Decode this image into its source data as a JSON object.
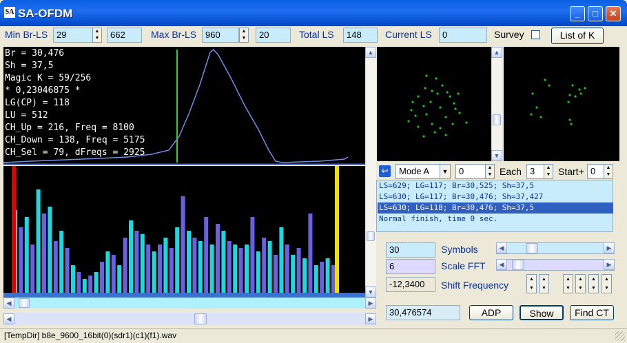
{
  "window": {
    "icon_text": "SA",
    "title": "SA-OFDM",
    "minimize": "_",
    "maximize": "□",
    "close": "✕"
  },
  "toolbar": {
    "min_br_ls_label": "Min Br-LS",
    "min_br_ls_value": "29",
    "min_br_ls_extra": "662",
    "max_br_ls_label": "Max Br-LS",
    "max_br_ls_value": "960",
    "max_br_ls_extra": "20",
    "total_ls_label": "Total LS",
    "total_ls_value": "148",
    "current_ls_label": "Current LS",
    "current_ls_value": "0",
    "survey_label": "Survey",
    "list_of_k_label": "List of K"
  },
  "info": {
    "lines": [
      "Br = 30,476",
      "Sh = 37,5",
      "Magic K = 59/256",
      "* 0,23046875 *",
      "LG(CP) = 118",
      "LU = 512",
      "CH_Up = 216, Freq = 8100",
      "CH_Down = 138, Freq = 5175",
      "CH_Sel = 79, dFreqs = 2925"
    ]
  },
  "mode": {
    "mode_value": "Mode A",
    "mode_num": "0",
    "each_label": "Each",
    "each_value": "3",
    "start_label": "Start+",
    "start_value": "0"
  },
  "log": {
    "lines": [
      "LS=629; LG=117; Br=30,525; Sh=37,5",
      "LS=630; LG=117; Br=30,476; Sh=37,427",
      "LS=630; LG=118; Br=30,476; Sh=37,5",
      "Normal finish, time 0 sec."
    ]
  },
  "params": {
    "symbols_value": "30",
    "symbols_label": "Symbols",
    "scale_fft_value": "6",
    "scale_fft_label": "Scale FFT",
    "shift_value": "-12,3400",
    "shift_label": "Shift Frequency"
  },
  "bottom": {
    "br_value": "30,476574",
    "adp_label": "ADP",
    "show_label": "Show",
    "find_ct_label": "Find CT"
  },
  "status": {
    "path": "[TempDir] b8e_9600_16bit(0)(sdr1)(c1)(f1).wav"
  },
  "colors": {
    "accent": "#0a2f96",
    "spectrum_line": "#6f8fe8",
    "bar_cyan": "#1ed8e0",
    "bar_violet": "#6b60e0",
    "marker_red": "#e00000",
    "marker_yellow": "#f0e000",
    "marker_green": "#30d030",
    "constellation_dot": "#20c020"
  }
}
